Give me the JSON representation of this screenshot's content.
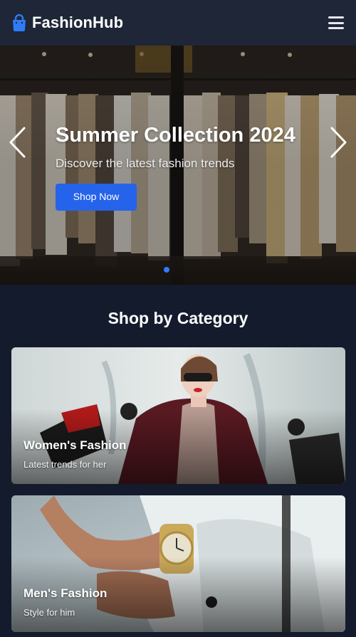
{
  "header": {
    "brand_name": "FashionHub",
    "brand_icon": "shopping-bag-icon",
    "menu_icon": "hamburger-menu-icon"
  },
  "hero": {
    "title": "Summer Collection 2024",
    "subtitle": "Discover the latest fashion trends",
    "cta_label": "Shop Now",
    "prev_icon": "chevron-left-icon",
    "next_icon": "chevron-right-icon",
    "slide_count": 1,
    "active_slide": 1
  },
  "categories": {
    "section_title": "Shop by Category",
    "items": [
      {
        "title": "Women's Fashion",
        "subtitle": "Latest trends for her"
      },
      {
        "title": "Men's Fashion",
        "subtitle": "Style for him"
      }
    ]
  },
  "colors": {
    "background": "#141b2d",
    "header": "#1e2637",
    "accent": "#2563eb",
    "dot_active": "#2e7cf6"
  }
}
